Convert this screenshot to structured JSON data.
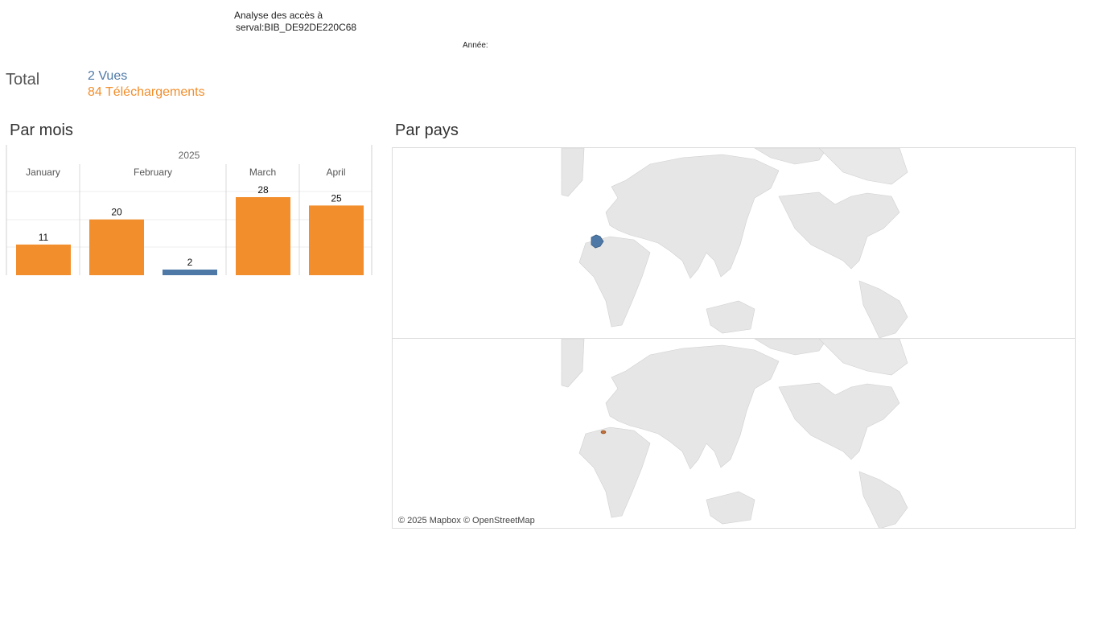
{
  "header": {
    "title_line1": "Analyse des accès à",
    "title_line2": "serval:BIB_DE92DE220C68",
    "year_label": "Année:"
  },
  "totals": {
    "label": "Total",
    "views": "2 Vues",
    "downloads": "84 Téléchargements",
    "views_color": "#4e79a7",
    "downloads_color": "#f28e2b"
  },
  "sections": {
    "by_month": "Par mois",
    "by_country": "Par pays"
  },
  "map": {
    "attribution": "© 2025 Mapbox © OpenStreetMap",
    "highlight_views": "France",
    "highlight_downloads": "Switzerland",
    "land_color": "#e6e6e6",
    "border_color": "#c8c8c8"
  },
  "chart_data": {
    "type": "bar",
    "year": "2025",
    "categories": [
      "January",
      "February",
      "March",
      "April"
    ],
    "series": [
      {
        "name": "Téléchargements",
        "color": "#f28e2b",
        "values": [
          11,
          20,
          28,
          25
        ]
      },
      {
        "name": "Vues",
        "color": "#4e79a7",
        "values": [
          0,
          2,
          0,
          0
        ]
      }
    ],
    "data_labels": [
      {
        "month": "January",
        "series": "Téléchargements",
        "value": 11
      },
      {
        "month": "February",
        "series": "Téléchargements",
        "value": 20
      },
      {
        "month": "February",
        "series": "Vues",
        "value": 2
      },
      {
        "month": "March",
        "series": "Téléchargements",
        "value": 28
      },
      {
        "month": "April",
        "series": "Téléchargements",
        "value": 25
      }
    ],
    "ylim": [
      0,
      30
    ]
  }
}
